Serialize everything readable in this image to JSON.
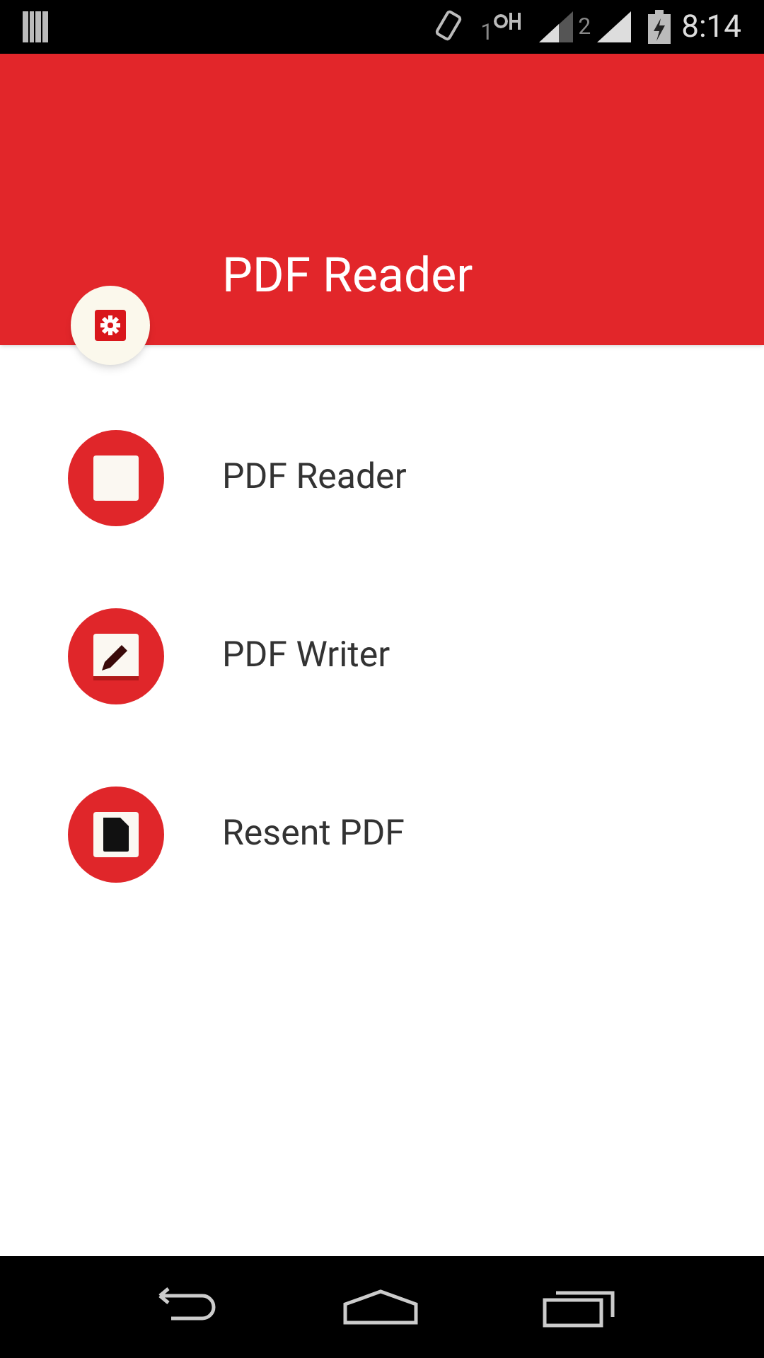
{
  "status_bar": {
    "sim1": "1",
    "sim2": "2",
    "time": "8:14"
  },
  "header": {
    "title": "PDF Reader"
  },
  "menu": [
    {
      "kind": "reader",
      "label": "PDF Reader"
    },
    {
      "kind": "writer",
      "label": "PDF Writer"
    },
    {
      "kind": "recent",
      "label": "Resent PDF"
    }
  ]
}
